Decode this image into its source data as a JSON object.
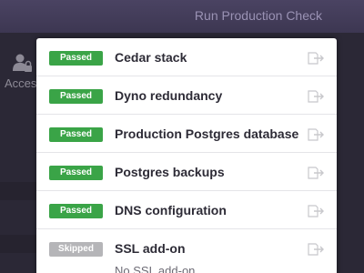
{
  "header": {
    "title": "Run Production Check"
  },
  "sidebar": {
    "access_label": "Access",
    "access_icon": "user-lock-icon"
  },
  "checks": [
    {
      "status": "Passed",
      "label": "Cedar stack",
      "icon": "document-arrow-icon"
    },
    {
      "status": "Passed",
      "label": "Dyno redundancy",
      "icon": "document-arrow-icon"
    },
    {
      "status": "Passed",
      "label": "Production Postgres database",
      "icon": "document-arrow-icon"
    },
    {
      "status": "Passed",
      "label": "Postgres backups",
      "icon": "document-arrow-icon"
    },
    {
      "status": "Passed",
      "label": "DNS configuration",
      "icon": "document-arrow-icon"
    },
    {
      "status": "Skipped",
      "label": "SSL add-on",
      "icon": "document-arrow-icon"
    }
  ],
  "ssl_detail": "No SSL add-on",
  "colors": {
    "passed": "#3aa447",
    "skipped": "#b5b5b8",
    "header_bg": "#4a4362",
    "page_bg": "#2b2836"
  }
}
